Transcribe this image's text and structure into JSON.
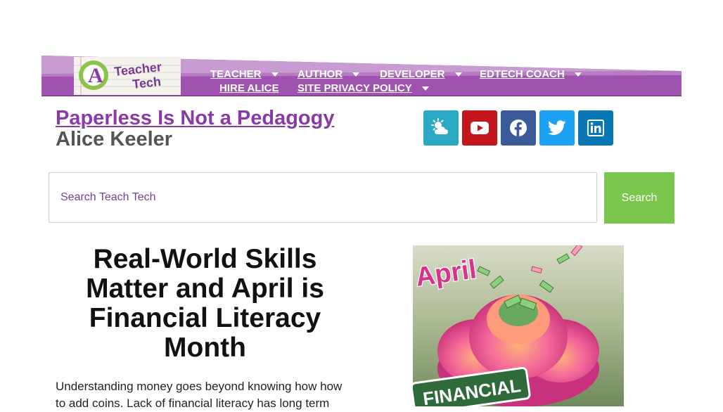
{
  "logo": {
    "line1": "Teacher",
    "line2": "Tech",
    "letter": "A"
  },
  "nav": {
    "items": [
      {
        "label": "TEACHER",
        "has_dropdown": true
      },
      {
        "label": "AUTHOR",
        "has_dropdown": true
      },
      {
        "label": "DEVELOPER",
        "has_dropdown": true
      },
      {
        "label": "EDTECH COACH",
        "has_dropdown": true
      },
      {
        "label": "HIRE ALICE",
        "has_dropdown": false
      },
      {
        "label": "SITE PRIVACY POLICY",
        "has_dropdown": true
      }
    ]
  },
  "site": {
    "title": "Paperless Is Not a Pedagogy",
    "subtitle": "Alice Keeler"
  },
  "social": [
    {
      "icon": "weather-cloud-sun-icon",
      "color": "#2aa8c4"
    },
    {
      "icon": "youtube-icon",
      "color": "#c4161c"
    },
    {
      "icon": "facebook-icon",
      "color": "#3b5a9a"
    },
    {
      "icon": "twitter-icon",
      "color": "#1da1f2"
    },
    {
      "icon": "linkedin-icon",
      "color": "#0a77b5"
    }
  ],
  "search": {
    "placeholder": "Search Teach Tech",
    "button_label": "Search"
  },
  "article": {
    "headline": "Real-World Skills Matter and April is Financial Literacy Month",
    "intro": "Understanding money goes beyond knowing how how to add coins. Lack of financial literacy has long term"
  },
  "feature_image": {
    "word_top": "April",
    "word_bottom": "FINANCIAL"
  },
  "colors": {
    "brand_purple": "#8a3aa6",
    "search_green": "#7bc74d",
    "banner_purple": "#9a4aaa"
  }
}
